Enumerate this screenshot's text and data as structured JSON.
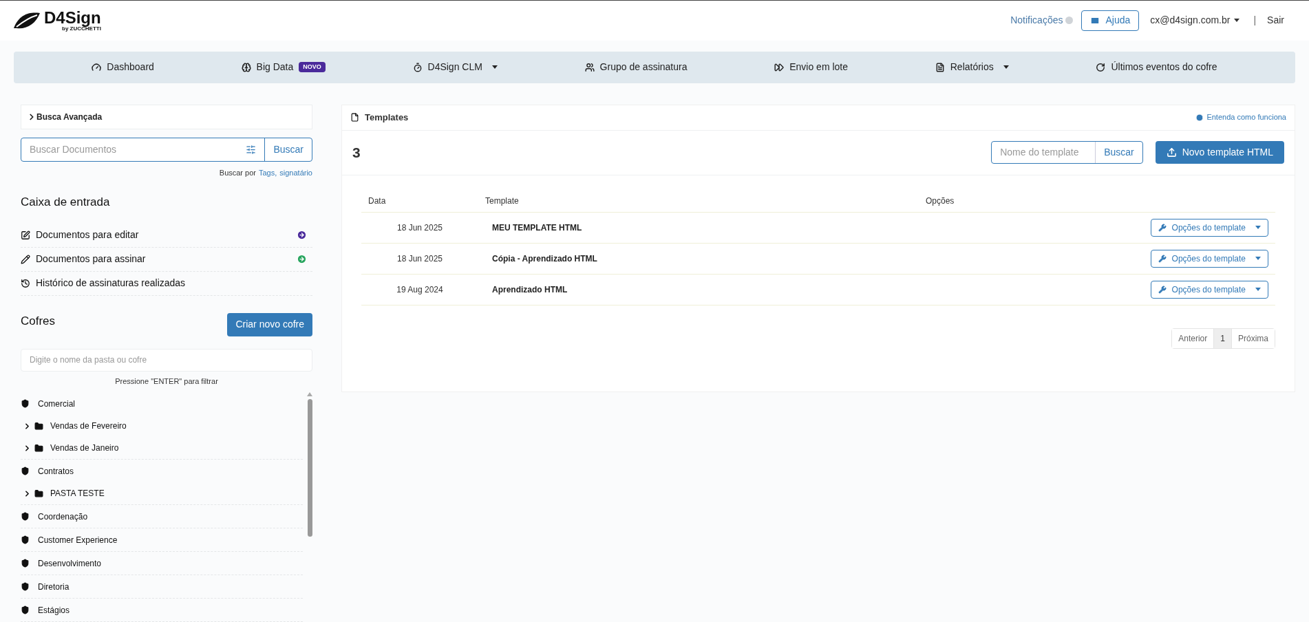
{
  "header": {
    "logo": {
      "name": "D4Sign",
      "byline": "by ZUCCHETTI"
    },
    "notifications": {
      "label": "Notificações"
    },
    "help_button": "Ajuda",
    "user_menu": "cx@d4sign.com.br",
    "separator": "|",
    "logout": "Sair"
  },
  "nav": [
    {
      "label": "Dashboard",
      "dropdown": false
    },
    {
      "label": "Big Data",
      "badge": "NOVO",
      "dropdown": false
    },
    {
      "label": "D4Sign CLM",
      "dropdown": true
    },
    {
      "label": "Grupo de assinatura",
      "dropdown": false
    },
    {
      "label": "Envio em lote",
      "dropdown": false
    },
    {
      "label": "Relatórios",
      "dropdown": true
    },
    {
      "label": "Últimos eventos do cofre",
      "dropdown": false
    }
  ],
  "sidebar": {
    "advanced_search": {
      "label": "Busca Avançada",
      "expanded": false
    },
    "search": {
      "placeholder": "Buscar Documentos",
      "button": "Buscar"
    },
    "search_hint": {
      "prefix": "Buscar por",
      "links": [
        "Tags,",
        "signatário"
      ]
    },
    "inbox": {
      "title": "Caixa de entrada",
      "items": [
        {
          "label": "Documentos para editar",
          "color": "#4a2a9b"
        },
        {
          "label": "Documentos para assinar",
          "color": "#28a55f"
        },
        {
          "label": "Histórico de assinaturas realizadas"
        }
      ]
    },
    "vaults": {
      "title": "Cofres",
      "create_button": "Criar novo cofre",
      "filter": {
        "placeholder": "Digite o nome da pasta ou cofre"
      },
      "filter_hint": "Pressione \"ENTER\" para filtrar",
      "tree": [
        {
          "label": "Comercial",
          "children": [
            {
              "label": "Vendas de Fevereiro",
              "expanded": false
            },
            {
              "label": "Vendas de Janeiro",
              "expanded": false
            }
          ]
        },
        {
          "label": "Contratos",
          "children": [
            {
              "label": "PASTA TESTE",
              "expanded": false
            }
          ]
        },
        {
          "label": "Coordenação"
        },
        {
          "label": "Customer Experience"
        },
        {
          "label": "Desenvolvimento"
        },
        {
          "label": "Diretoria"
        },
        {
          "label": "Estágios"
        }
      ]
    }
  },
  "templates": {
    "title": "Templates",
    "help_link": "Entenda como funciona",
    "count": "3",
    "search": {
      "placeholder": "Nome do template",
      "button": "Buscar"
    },
    "new_button": "Novo template HTML",
    "table": {
      "columns": [
        "Data",
        "Template",
        "Opções"
      ],
      "rows": [
        {
          "date": "18 Jun 2025",
          "name": "MEU TEMPLATE HTML",
          "options": "Opções do template"
        },
        {
          "date": "18 Jun 2025",
          "name": "Cópia - Aprendizado HTML",
          "options": "Opções do template"
        },
        {
          "date": "19 Aug 2024",
          "name": "Aprendizado HTML",
          "options": "Opções do template"
        }
      ]
    },
    "pagination": [
      {
        "label": "Anterior",
        "selected": false
      },
      {
        "label": "1",
        "selected": true
      },
      {
        "label": "Próxima",
        "selected": false
      }
    ]
  }
}
